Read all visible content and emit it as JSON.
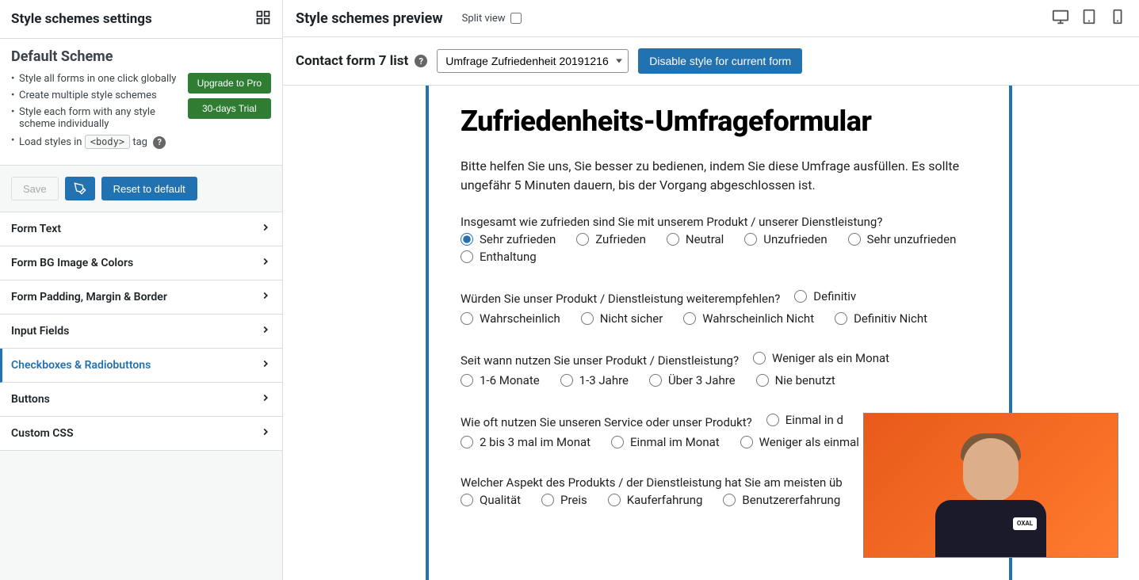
{
  "sidebar": {
    "title": "Style schemes settings",
    "scheme_title": "Default Scheme",
    "bullets": [
      "Style all forms in one click globally",
      "Create multiple style schemes",
      "Style each form with any style scheme individually"
    ],
    "load_styles_prefix": "Load styles in",
    "load_styles_code": "<body>",
    "load_styles_suffix": "tag",
    "upgrade": "Upgrade to Pro",
    "trial": "30-days Trial",
    "save": "Save",
    "reset": "Reset to default",
    "accordion": [
      {
        "label": "Form Text",
        "active": false
      },
      {
        "label": "Form BG Image & Colors",
        "active": false
      },
      {
        "label": "Form Padding, Margin & Border",
        "active": false
      },
      {
        "label": "Input Fields",
        "active": false
      },
      {
        "label": "Checkboxes & Radiobuttons",
        "active": true
      },
      {
        "label": "Buttons",
        "active": false
      },
      {
        "label": "Custom CSS",
        "active": false
      }
    ]
  },
  "preview": {
    "title": "Style schemes preview",
    "split_view": "Split view",
    "form_list_label": "Contact form 7 list",
    "form_select_value": "Umfrage Zufriedenheit 20191216",
    "disable_btn": "Disable style for current form"
  },
  "form": {
    "heading": "Zufriedenheits-Umfrageformular",
    "intro": "Bitte helfen Sie uns, Sie besser zu bedienen, indem Sie diese Umfrage ausfüllen. Es sollte ungefähr 5 Minuten dauern, bis der Vorgang abgeschlossen ist.",
    "q1": {
      "label": "Insgesamt wie zufrieden sind Sie mit unserem Produkt / unserer Dienstleistung?",
      "options": [
        "Sehr zufrieden",
        "Zufrieden",
        "Neutral",
        "Unzufrieden",
        "Sehr unzufrieden",
        "Enthaltung"
      ],
      "selected": 0
    },
    "q2": {
      "label": "Würden Sie unser Produkt / Dienstleistung weiterempfehlen?",
      "options": [
        "Definitiv",
        "Wahrscheinlich",
        "Nicht sicher",
        "Wahrscheinlich Nicht",
        "Definitiv Nicht"
      ]
    },
    "q3": {
      "label": "Seit wann nutzen Sie unser Produkt / Dienstleistung?",
      "options": [
        "Weniger als ein Monat",
        "1-6 Monate",
        "1-3 Jahre",
        "Über 3 Jahre",
        "Nie benutzt"
      ]
    },
    "q4": {
      "label": "Wie oft nutzen Sie unseren Service oder unser Produkt?",
      "options": [
        "Einmal in d",
        "2 bis 3 mal im Monat",
        "Einmal im Monat",
        "Weniger als einmal"
      ]
    },
    "q5": {
      "label": "Welcher Aspekt des Produkts / der Dienstleistung hat Sie am meisten üb",
      "options": [
        "Qualität",
        "Preis",
        "Kauferfahrung",
        "Benutzererfahrung"
      ]
    }
  },
  "webcam_badge": "OXAL"
}
